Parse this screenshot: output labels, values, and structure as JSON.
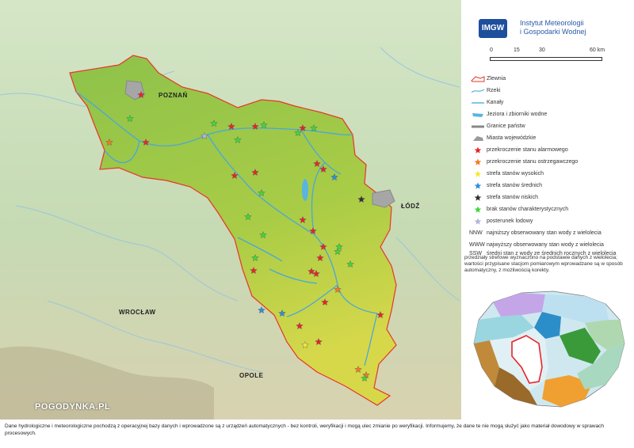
{
  "institute": {
    "logo_text": "IMGW",
    "name_line1": "Instytut Meteorologii",
    "name_line2": "i Gospodarki Wodnej"
  },
  "scale": {
    "ticks": [
      "0",
      "15",
      "30",
      "",
      "60 km"
    ]
  },
  "legend": [
    {
      "symbol": "zlewnia",
      "label": "Zlewnia",
      "color": "#e8342a"
    },
    {
      "symbol": "rzeki",
      "label": "Rzeki",
      "color": "#3ca0d8"
    },
    {
      "symbol": "kanaly",
      "label": "Kanały",
      "color": "#5ab4e0"
    },
    {
      "symbol": "jeziora",
      "label": "Jeziora i zbiorniki wodne",
      "color": "#5ab4e0"
    },
    {
      "symbol": "granice",
      "label": "Granice państw",
      "color": "#888888"
    },
    {
      "symbol": "miasta",
      "label": "Miasta wojewódzkie",
      "color": "#9a9a9a"
    },
    {
      "symbol": "star",
      "label": "przekroczenie stanu alarmowego",
      "color": "#e8242a"
    },
    {
      "symbol": "star",
      "label": "przekroczenie stanu ostrzegawczego",
      "color": "#f47a20"
    },
    {
      "symbol": "star",
      "label": "strefa stanów wysokich",
      "color": "#f7e83a"
    },
    {
      "symbol": "star",
      "label": "strefa stanów średnich",
      "color": "#2a8ee0"
    },
    {
      "symbol": "star",
      "label": "strefa stanów niskich",
      "color": "#333333"
    },
    {
      "symbol": "star",
      "label": "brak stanów charakterystycznych",
      "color": "#3fd83a"
    },
    {
      "symbol": "star",
      "label": "posterunek lodowy",
      "color": "#b4b4d8"
    }
  ],
  "abbreviations": [
    {
      "abbr": "NNW",
      "text": "najniższy obserwowany stan wody z wielolecia"
    },
    {
      "abbr": "WWW",
      "text": "najwyższy obserwowany stan wody z wielolecia"
    },
    {
      "abbr": "SSW",
      "text": "średni stan z wody ze średnich rocznych z wielolecia"
    }
  ],
  "note": "przedziały strefowe wyznaczono na podstawie danych z wielolecia; wartości przypisane stacjom pomiarowym wprowadzane są w sposób automatyczny, z możliwością korekty.",
  "map_labels": {
    "poznan": "POZNAŃ",
    "lodz": "ŁÓDŹ",
    "wroclaw": "WROCŁAW",
    "opole": "OPOLE",
    "watermark": "POGODYNKA.PL"
  },
  "footer": "Dane hydrologiczne i meteorologiczne pochodzą z operacyjnej bazy danych i wprowadzone są z urządzeń automatycznych - bez kontroli, weryfikacji i mogą ulec zmianie po weryfikacji. Informujemy, że dane te nie mogą służyć jako materiał dowodowy w sprawach procesowych.",
  "colors": {
    "basin_fill": "#9dc94a",
    "basin_border": "#e8342a",
    "outside": "#c8dcc0",
    "river": "#4aa6dc"
  },
  "stations": [
    {
      "status": "alarm"
    },
    {
      "status": "alarm"
    },
    {
      "status": "alarm"
    },
    {
      "status": "alarm"
    },
    {
      "status": "alarm"
    },
    {
      "status": "alarm"
    },
    {
      "status": "alarm"
    },
    {
      "status": "alarm"
    },
    {
      "status": "alarm"
    },
    {
      "status": "alarm"
    },
    {
      "status": "alarm"
    },
    {
      "status": "alarm"
    },
    {
      "status": "alarm"
    },
    {
      "status": "alarm"
    },
    {
      "status": "alarm"
    },
    {
      "status": "alarm"
    },
    {
      "status": "alarm"
    },
    {
      "status": "alarm"
    },
    {
      "status": "alarm"
    },
    {
      "status": "alarm"
    },
    {
      "status": "warning"
    },
    {
      "status": "warning"
    },
    {
      "status": "warning"
    },
    {
      "status": "warning"
    },
    {
      "status": "none"
    },
    {
      "status": "none"
    },
    {
      "status": "none"
    },
    {
      "status": "none"
    },
    {
      "status": "none"
    },
    {
      "status": "none"
    },
    {
      "status": "none"
    },
    {
      "status": "none"
    },
    {
      "status": "none"
    },
    {
      "status": "none"
    },
    {
      "status": "none"
    },
    {
      "status": "none"
    },
    {
      "status": "none"
    },
    {
      "status": "none"
    },
    {
      "status": "medium"
    },
    {
      "status": "medium"
    },
    {
      "status": "medium"
    },
    {
      "status": "high"
    },
    {
      "status": "low"
    },
    {
      "status": "ice"
    }
  ]
}
